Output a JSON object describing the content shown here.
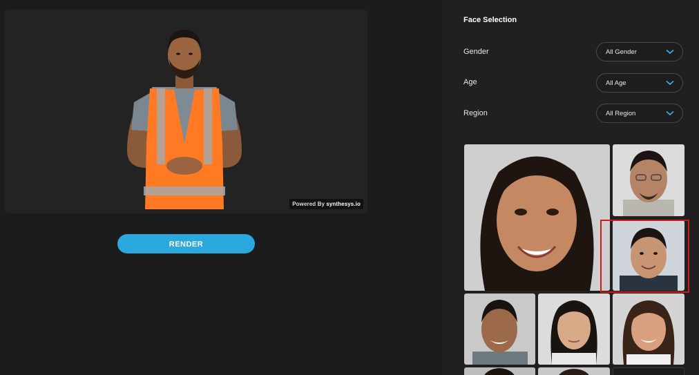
{
  "preview": {
    "powered_prefix": "Powered By",
    "powered_brand": "synthesys.io"
  },
  "render_label": "RENDER",
  "panel": {
    "title": "Face Selection",
    "filters": [
      {
        "label": "Gender",
        "value": "All Gender"
      },
      {
        "label": "Age",
        "value": "All Age"
      },
      {
        "label": "Region",
        "value": "All Region"
      }
    ]
  },
  "icons": {
    "chevron": "chevron-down-icon"
  },
  "colors": {
    "accent": "#2ba8de",
    "chevron": "#3cb4e6",
    "selection": "#d11a1a",
    "vest": "#ff7a22"
  }
}
